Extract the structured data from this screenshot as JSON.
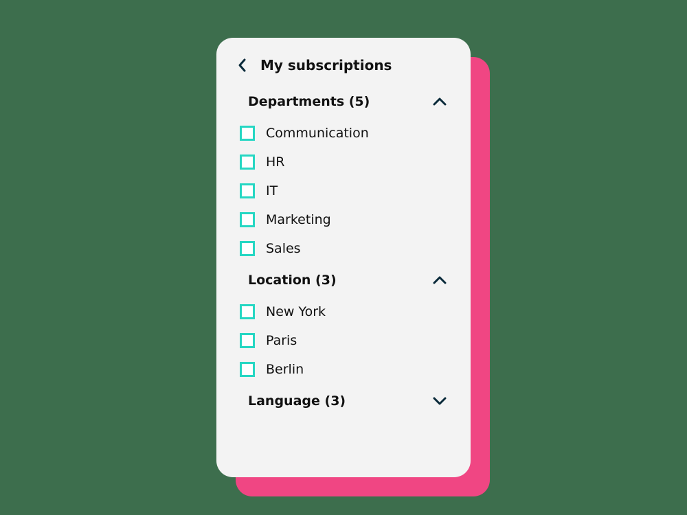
{
  "header": {
    "title": "My subscriptions"
  },
  "sections": [
    {
      "key": "departments",
      "title": "Departments (5)",
      "expanded": true,
      "items": [
        "Communication",
        "HR",
        "IT",
        "Marketing",
        "Sales"
      ]
    },
    {
      "key": "location",
      "title": "Location (3)",
      "expanded": true,
      "items": [
        "New York",
        "Paris",
        "Berlin"
      ]
    },
    {
      "key": "language",
      "title": "Language (3)",
      "expanded": false,
      "items": []
    }
  ],
  "colors": {
    "background": "#3d6e4d",
    "accent_pink": "#f04683",
    "panel": "#f3f3f3",
    "checkbox_border": "#26d7c3",
    "chevron": "#0a2a3a"
  }
}
